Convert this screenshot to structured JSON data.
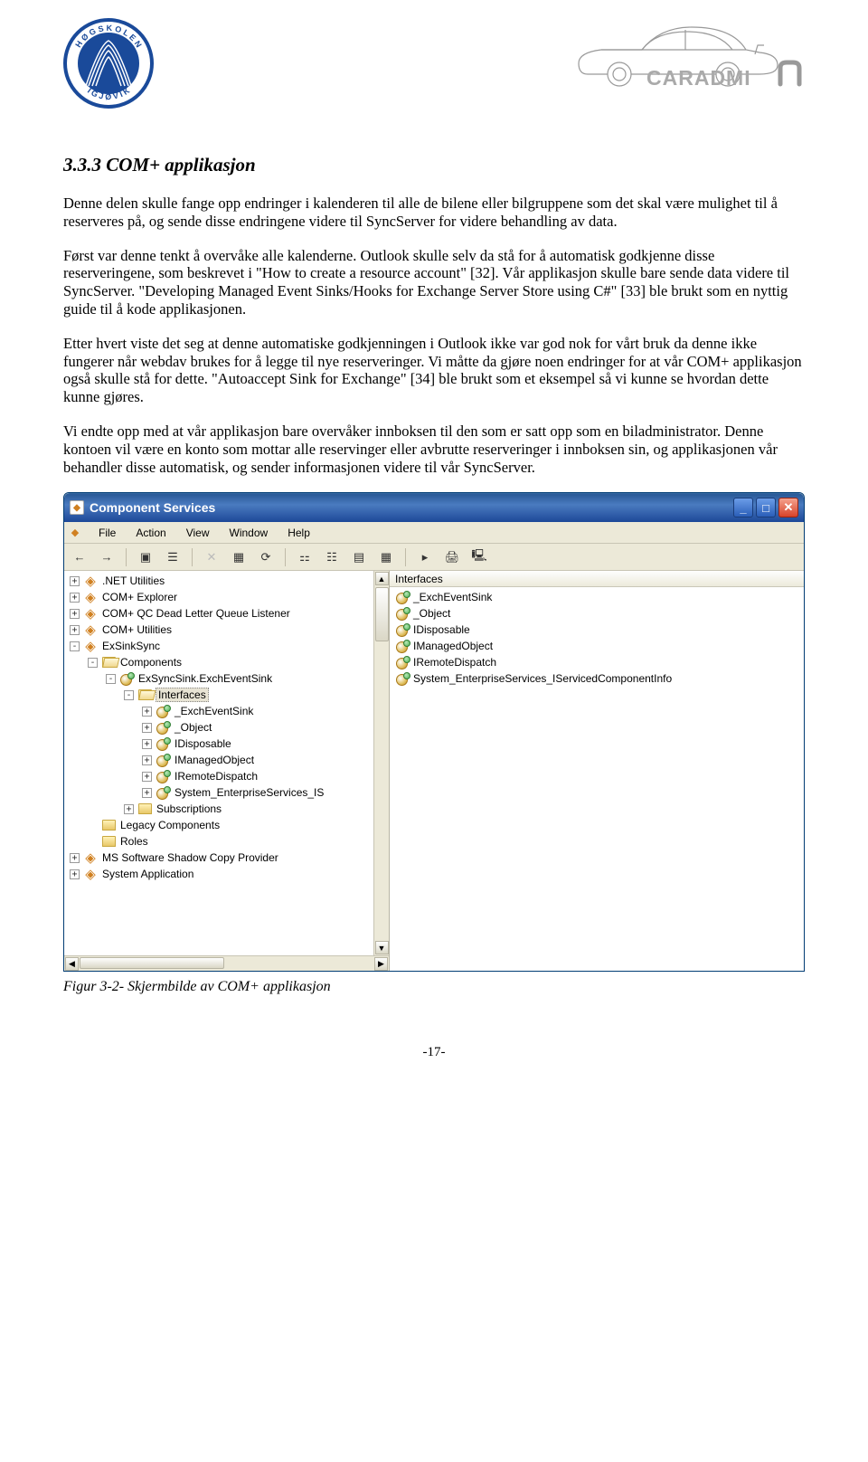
{
  "section": {
    "number": "3.3.3",
    "title": "COM+ applikasjon"
  },
  "paragraphs": {
    "p1": "Denne delen skulle fange opp endringer i kalenderen til alle de bilene eller bilgruppene som det skal være mulighet til å reserveres på, og sende disse endringene videre til SyncServer for videre behandling av data.",
    "p2": "Først var denne tenkt å overvåke alle kalenderne. Outlook skulle selv da stå for å automatisk godkjenne disse reserveringene, som beskrevet i \"How to create a resource account\" [32]. Vår applikasjon skulle bare sende data videre til SyncServer. \"Developing Managed Event Sinks/Hooks for Exchange Server Store using C#\" [33] ble brukt som en nyttig guide til å kode applikasjonen.",
    "p3": "Etter hvert viste det seg at denne automatiske godkjenningen i Outlook ikke var god nok for vårt bruk da denne ikke fungerer når webdav brukes for å legge til nye reserveringer. Vi måtte da gjøre noen endringer for at vår COM+ applikasjon også skulle stå for dette. \"Autoaccept Sink for Exchange\" [34] ble brukt som et eksempel så vi kunne se hvordan dette kunne gjøres.",
    "p4": "Vi endte opp med at vår applikasjon bare overvåker innboksen til den som er satt opp som en biladministrator. Denne kontoen vil være en konto som mottar alle reservinger eller avbrutte reserveringer i innboksen sin, og applikasjonen vår behandler disse automatisk, og sender informasjonen videre til vår SyncServer."
  },
  "screenshot": {
    "window_title": "Component Services",
    "menubar": [
      "File",
      "Action",
      "View",
      "Window",
      "Help"
    ],
    "tree_header": "",
    "list_header": "Interfaces",
    "tree": [
      {
        "depth": 0,
        "exp": "+",
        "icon": "com",
        "label": ".NET Utilities"
      },
      {
        "depth": 0,
        "exp": "+",
        "icon": "com",
        "label": "COM+ Explorer"
      },
      {
        "depth": 0,
        "exp": "+",
        "icon": "com",
        "label": "COM+ QC Dead Letter Queue Listener"
      },
      {
        "depth": 0,
        "exp": "+",
        "icon": "com",
        "label": "COM+ Utilities"
      },
      {
        "depth": 0,
        "exp": "-",
        "icon": "com",
        "label": "ExSinkSync"
      },
      {
        "depth": 1,
        "exp": "-",
        "icon": "folder-open",
        "label": "Components"
      },
      {
        "depth": 2,
        "exp": "-",
        "icon": "iface",
        "label": "ExSyncSink.ExchEventSink"
      },
      {
        "depth": 3,
        "exp": "-",
        "icon": "folder-open",
        "label": "Interfaces",
        "selected": true
      },
      {
        "depth": 4,
        "exp": "+",
        "icon": "iface",
        "label": "_ExchEventSink"
      },
      {
        "depth": 4,
        "exp": "+",
        "icon": "iface",
        "label": "_Object"
      },
      {
        "depth": 4,
        "exp": "+",
        "icon": "iface",
        "label": "IDisposable"
      },
      {
        "depth": 4,
        "exp": "+",
        "icon": "iface",
        "label": "IManagedObject"
      },
      {
        "depth": 4,
        "exp": "+",
        "icon": "iface",
        "label": "IRemoteDispatch"
      },
      {
        "depth": 4,
        "exp": "+",
        "icon": "iface",
        "label": "System_EnterpriseServices_IS"
      },
      {
        "depth": 3,
        "exp": "+",
        "icon": "folder",
        "label": "Subscriptions"
      },
      {
        "depth": 1,
        "exp": "",
        "icon": "folder",
        "label": "Legacy Components"
      },
      {
        "depth": 1,
        "exp": "",
        "icon": "folder",
        "label": "Roles"
      },
      {
        "depth": 0,
        "exp": "+",
        "icon": "com",
        "label": "MS Software Shadow Copy Provider"
      },
      {
        "depth": 0,
        "exp": "+",
        "icon": "com",
        "label": "System Application"
      }
    ],
    "list": [
      "_ExchEventSink",
      "_Object",
      "IDisposable",
      "IManagedObject",
      "IRemoteDispatch",
      "System_EnterpriseServices_IServicedComponentInfo"
    ]
  },
  "caption": "Figur 3-2- Skjermbilde av COM+ applikasjon",
  "page_number": "-17-"
}
